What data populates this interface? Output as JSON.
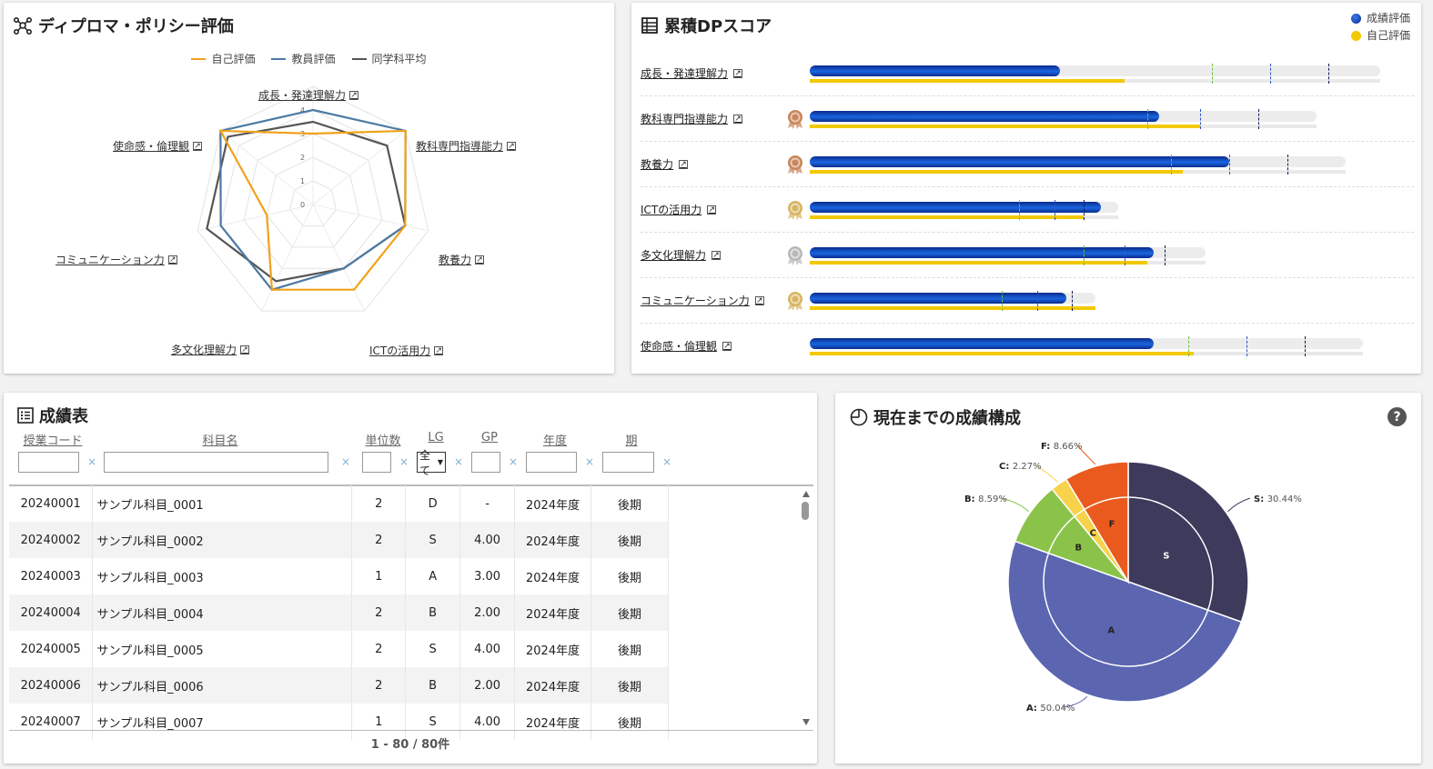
{
  "radar": {
    "title": "ディプロマ・ポリシー評価",
    "legend": [
      {
        "label": "自己評価",
        "color": "#f0a21a"
      },
      {
        "label": "教員評価",
        "color": "#4c7aa5"
      },
      {
        "label": "同学科平均",
        "color": "#555555"
      }
    ],
    "axes": [
      "成長・発達理解力",
      "教科専門指導能力",
      "教養力",
      "ICTの活用力",
      "多文化理解力",
      "コミュニケーション力",
      "使命感・倫理観"
    ],
    "tick_labels": [
      "0",
      "1",
      "2",
      "3",
      "4"
    ],
    "max": 5,
    "series": {
      "self": [
        3,
        5,
        4,
        4,
        4,
        2,
        5
      ],
      "teacher": [
        4,
        5,
        4,
        3,
        4,
        4,
        5
      ],
      "average": [
        3.5,
        4,
        4,
        3,
        3.6,
        4.6,
        4.6
      ]
    }
  },
  "dp": {
    "title": "累積DPスコア",
    "legend": [
      {
        "label": "成績評価",
        "color": "#0a3aa8"
      },
      {
        "label": "自己評価",
        "color": "#f2c900"
      }
    ],
    "rows": [
      {
        "name": "成長・発達理解力",
        "medal": "none",
        "track": 0.98,
        "grade": 0.43,
        "self": 0.54,
        "marks": [
          0.69,
          0.79,
          0.89
        ]
      },
      {
        "name": "教科専門指導能力",
        "medal": "bronze",
        "track": 0.87,
        "grade": 0.6,
        "self": 0.67,
        "marks": [
          0.58,
          0.67,
          0.77
        ]
      },
      {
        "name": "教養力",
        "medal": "bronze",
        "track": 0.92,
        "grade": 0.72,
        "self": 0.64,
        "marks": [
          0.62,
          0.72,
          0.82
        ]
      },
      {
        "name": "ICTの活用力",
        "medal": "gold",
        "track": 0.53,
        "grade": 0.5,
        "self": 0.47,
        "marks": [
          0.36,
          0.42,
          0.47
        ]
      },
      {
        "name": "多文化理解力",
        "medal": "silver",
        "track": 0.68,
        "grade": 0.59,
        "self": 0.58,
        "marks": [
          0.47,
          0.54,
          0.61
        ]
      },
      {
        "name": "コミュニケーション力",
        "medal": "gold",
        "track": 0.49,
        "grade": 0.44,
        "self": 0.49,
        "marks": [
          0.33,
          0.39,
          0.45
        ]
      },
      {
        "name": "使命感・倫理観",
        "medal": "none",
        "track": 0.95,
        "grade": 0.59,
        "self": 0.66,
        "marks": [
          0.65,
          0.75,
          0.85
        ]
      }
    ]
  },
  "table": {
    "title": "成績表",
    "headers": [
      "授業コード",
      "科目名",
      "単位数",
      "LG",
      "GP",
      "年度",
      "期"
    ],
    "lg_select": "全て",
    "clear": "×",
    "rows": [
      [
        "20240001",
        "サンプル科目_0001",
        "2",
        "D",
        "-",
        "2024年度",
        "後期"
      ],
      [
        "20240002",
        "サンプル科目_0002",
        "2",
        "S",
        "4.00",
        "2024年度",
        "後期"
      ],
      [
        "20240003",
        "サンプル科目_0003",
        "1",
        "A",
        "3.00",
        "2024年度",
        "後期"
      ],
      [
        "20240004",
        "サンプル科目_0004",
        "2",
        "B",
        "2.00",
        "2024年度",
        "後期"
      ],
      [
        "20240005",
        "サンプル科目_0005",
        "2",
        "S",
        "4.00",
        "2024年度",
        "後期"
      ],
      [
        "20240006",
        "サンプル科目_0006",
        "2",
        "B",
        "2.00",
        "2024年度",
        "後期"
      ],
      [
        "20240007",
        "サンプル科目_0007",
        "1",
        "S",
        "4.00",
        "2024年度",
        "後期"
      ]
    ],
    "pager": "1 - 80 / 80件"
  },
  "chart_data": {
    "type": "pie",
    "title": "現在までの成績構成",
    "categories": [
      "S",
      "A",
      "B",
      "C",
      "F"
    ],
    "values": [
      30.44,
      50.04,
      8.59,
      2.27,
      8.66
    ],
    "labels": [
      "S: 30.44%",
      "A: 50.04%",
      "B: 8.59%",
      "C: 2.27%",
      "F: 8.66%"
    ],
    "colors": [
      "#3d3a5c",
      "#5b65b0",
      "#8bc34a",
      "#f8d24a",
      "#ea5a1e"
    ]
  },
  "pie_help": "?"
}
